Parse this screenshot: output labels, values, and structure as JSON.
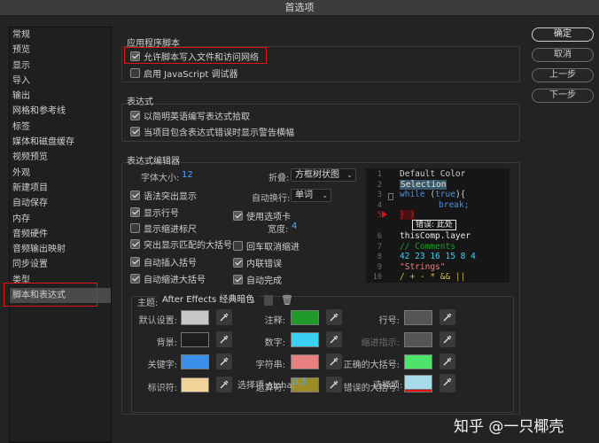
{
  "window": {
    "title": "首选项"
  },
  "sidebar": {
    "items": [
      "常规",
      "预览",
      "显示",
      "导入",
      "输出",
      "网格和参考线",
      "标签",
      "媒体和磁盘缓存",
      "视频预览",
      "外观",
      "新建项目",
      "自动保存",
      "内存",
      "音频硬件",
      "音频输出映射",
      "同步设置",
      "类型",
      "脚本和表达式"
    ],
    "selected_index": 17
  },
  "buttons": {
    "ok": "确定",
    "cancel": "取消",
    "prev": "上一步",
    "next": "下一步"
  },
  "app_scripts": {
    "title": "应用程序脚本",
    "allow_network": {
      "label": "允许脚本写入文件和访问网络",
      "checked": true
    },
    "enable_debugger": {
      "label": "启用 JavaScript 调试器",
      "checked": false
    }
  },
  "expressions": {
    "title": "表达式",
    "english_pickwhip": {
      "label": "以简明英语编写表达式拾取",
      "checked": true
    },
    "warn_banner": {
      "label": "当项目包含表达式错误时显示警告横幅",
      "checked": true
    }
  },
  "editor": {
    "title": "表达式编辑器",
    "font_size_label": "字体大小:",
    "font_size_value": "12",
    "fold_label": "折叠:",
    "fold_value": "方框树状图",
    "autowrap_label": "自动换行:",
    "autowrap_value": "单词",
    "use_tabs": {
      "label": "使用选项卡",
      "checked": true
    },
    "width_label": "宽度:",
    "width_value": "4",
    "options": [
      {
        "label": "语法突出显示",
        "checked": true
      },
      {
        "label": "显示行号",
        "checked": true
      },
      {
        "label": "显示缩进标尺",
        "checked": false
      },
      {
        "label": "突出显示匹配的大括号",
        "checked": true
      },
      {
        "label": "自动插入括号",
        "checked": true
      },
      {
        "label": "自动缩进大括号",
        "checked": true
      }
    ],
    "options_right": [
      {
        "label": "回车取消缩进",
        "checked": false
      },
      {
        "label": "内联错误",
        "checked": true
      },
      {
        "label": "自动完成",
        "checked": true
      }
    ]
  },
  "code_preview": {
    "line_numbers": [
      "1",
      "2",
      "3",
      "4",
      "5",
      "6",
      "7",
      "8",
      "9",
      "10"
    ],
    "lines": {
      "l1": "Default Color",
      "l2": "Selection",
      "l3a": "while",
      "l3b": " (",
      "l3c": "true",
      "l3d": "){",
      "l4": "break;",
      "l5": "} }",
      "err": "错误: 此处",
      "l6": "thisComp.layer",
      "l7": "// Comments",
      "l8": "42 23 16 15 8 4",
      "l9": "\"Strings\"",
      "l10": "/ + - * && ||"
    }
  },
  "theme": {
    "label": "主题:",
    "value": "After Effects 经典暗色",
    "colors": [
      {
        "label": "默认设置:",
        "color": "#c8c8c8"
      },
      {
        "label": "背景:",
        "color": "#1e1e1e"
      },
      {
        "label": "关键字:",
        "color": "#3a8fe8"
      },
      {
        "label": "标识符:",
        "color": "#f2d39a"
      },
      {
        "label": "注释:",
        "color": "#1f9a2a"
      },
      {
        "label": "数字:",
        "color": "#3ad0f2"
      },
      {
        "label": "字符串:",
        "color": "#e88080"
      },
      {
        "label": "运算符:",
        "color": "#9a8c26"
      },
      {
        "label": "行号:",
        "color": "#555555"
      },
      {
        "label": "缩进指示:",
        "color": "#555555"
      },
      {
        "label": "正确的大括号:",
        "color": "#4ce46a"
      },
      {
        "label": "错误的大括号:",
        "color": "#e01010"
      }
    ],
    "alpha_label": "选择项 Alpha:",
    "alpha_value": "0.3",
    "selection_label": "选择项:",
    "selection_color": "#a8dcea"
  },
  "watermark": "知乎 @一只椰壳"
}
